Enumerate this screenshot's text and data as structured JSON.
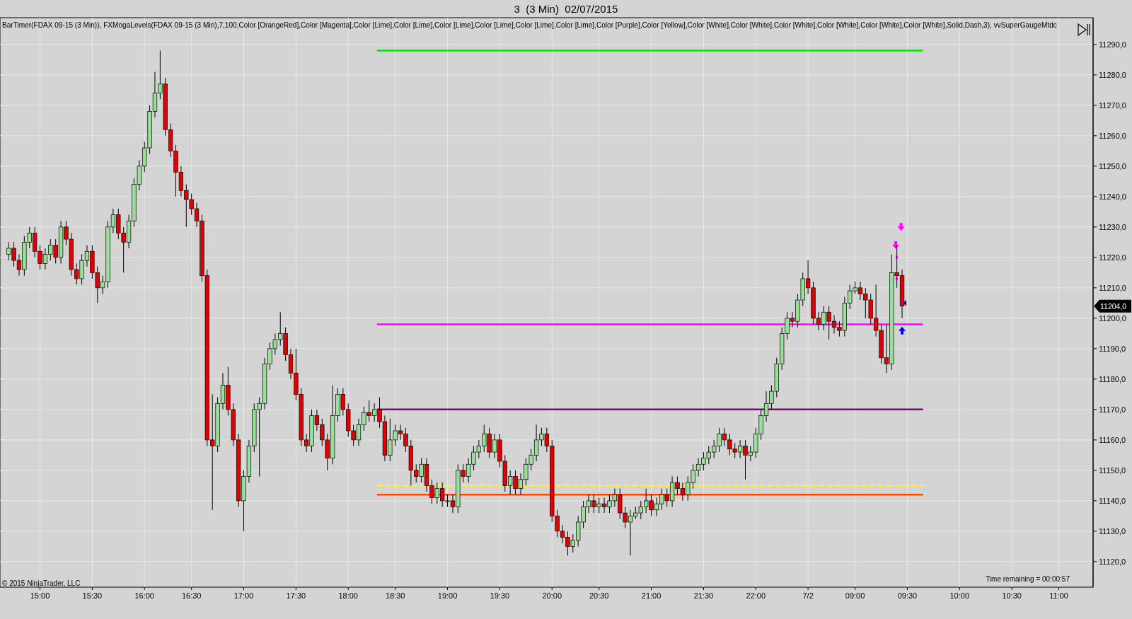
{
  "window": {
    "title": "3  (3 Min)  02/07/2015"
  },
  "chart": {
    "indicator_text": "BarTimer(FDAX 09-15 (3 Min)), FXMogaLevels(FDAX 09-15 (3 Min),7,100,Color [OrangeRed],Color [Magenta],Color [Lime],Color [Lime],Color [Lime],Color [Lime],Color [Lime],Color [Lime],Color [Purple],Color [Yellow],Color [White],Color [White],Color [White],Color [White],Color [White],Color [White],Solid,Dash,3), vvSuperGaugeMtdc",
    "copyright": "© 2015 NinjaTrader, LLC",
    "time_remaining": "Time remaining = 00:00:57",
    "last_price_label": "11204,0",
    "chart_data": {
      "type": "candlestick",
      "grid": true,
      "ylim": [
        11111.6,
        11298.8
      ],
      "categories": [
        null,
        null,
        null,
        null,
        null,
        null,
        "15:00",
        null,
        null,
        null,
        null,
        null,
        null,
        null,
        null,
        null,
        "15:30",
        null,
        null,
        null,
        null,
        null,
        null,
        null,
        null,
        null,
        "16:00",
        null,
        null,
        null,
        null,
        null,
        null,
        null,
        null,
        "16:30",
        null,
        null,
        null,
        null,
        null,
        null,
        null,
        null,
        null,
        "17:00",
        null,
        null,
        null,
        null,
        null,
        null,
        null,
        null,
        null,
        "17:30",
        null,
        null,
        null,
        null,
        null,
        null,
        null,
        null,
        null,
        "18:00",
        null,
        null,
        null,
        null,
        null,
        null,
        null,
        null,
        "18:30",
        null,
        null,
        null,
        null,
        null,
        null,
        null,
        null,
        null,
        "19:00",
        null,
        null,
        null,
        null,
        null,
        null,
        null,
        null,
        null,
        "19:30",
        null,
        null,
        null,
        null,
        null,
        null,
        null,
        null,
        null,
        "20:00",
        null,
        null,
        null,
        null,
        null,
        null,
        null,
        null,
        "20:30",
        null,
        null,
        null,
        null,
        null,
        null,
        null,
        null,
        null,
        "21:00",
        null,
        null,
        null,
        null,
        null,
        null,
        null,
        null,
        null,
        "21:30",
        null,
        null,
        null,
        null,
        null,
        null,
        null,
        null,
        null,
        "22:00",
        null,
        null,
        null,
        null,
        null,
        null,
        null,
        null,
        null,
        "7/2",
        null,
        null,
        null,
        null,
        null,
        null,
        null,
        null,
        "09:00",
        null,
        null,
        null,
        null,
        null,
        null,
        null,
        null,
        null,
        "09:30",
        null,
        null,
        null,
        null,
        null,
        null,
        null,
        null,
        null,
        "10:00",
        null,
        null,
        null,
        null,
        null,
        null,
        null,
        null,
        null,
        "10:30",
        null,
        null,
        null,
        null,
        null,
        null,
        null,
        null,
        "11:00",
        null,
        null,
        null,
        null,
        null,
        null
      ],
      "yticks": [
        {
          "value": 11120,
          "label": "11120,0"
        },
        {
          "value": 11130,
          "label": "11130,0"
        },
        {
          "value": 11140,
          "label": "11140,0"
        },
        {
          "value": 11150,
          "label": "11150,0"
        },
        {
          "value": 11160,
          "label": "11160,0"
        },
        {
          "value": 11170,
          "label": "11170,0"
        },
        {
          "value": 11180,
          "label": "11180,0"
        },
        {
          "value": 11190,
          "label": "11190,0"
        },
        {
          "value": 11200,
          "label": "11200,0"
        },
        {
          "value": 11210,
          "label": "11210,0"
        },
        {
          "value": 11220,
          "label": "11220,0"
        },
        {
          "value": 11230,
          "label": "11230,0"
        },
        {
          "value": 11240,
          "label": "11240,0"
        },
        {
          "value": 11250,
          "label": "11250,0"
        },
        {
          "value": 11260,
          "label": "11260,0"
        },
        {
          "value": 11270,
          "label": "11270,0"
        },
        {
          "value": 11280,
          "label": "11280,0"
        },
        {
          "value": 11290,
          "label": "11290,0"
        }
      ],
      "ohlc": [
        [
          11221,
          11225,
          11219,
          11223
        ],
        [
          11223,
          11225,
          11217,
          11219
        ],
        [
          11219,
          11221,
          11214,
          11216
        ],
        [
          11216,
          11227,
          11214,
          11225
        ],
        [
          11225,
          11230,
          11223,
          11228
        ],
        [
          11228,
          11230,
          11220,
          11222
        ],
        [
          11222,
          11224,
          11216,
          11218
        ],
        [
          11218,
          11223,
          11216,
          11221
        ],
        [
          11221,
          11226,
          11219,
          11224
        ],
        [
          11224,
          11226,
          11218,
          11220
        ],
        [
          11220,
          11232,
          11218,
          11230
        ],
        [
          11230,
          11232,
          11224,
          11226
        ],
        [
          11226,
          11228,
          11214,
          11216
        ],
        [
          11216,
          11218,
          11211,
          11213
        ],
        [
          11213,
          11221,
          11211,
          11219
        ],
        [
          11219,
          11224,
          11217,
          11222
        ],
        [
          11222,
          11224,
          11213,
          11215
        ],
        [
          11215,
          11217,
          11205,
          11210
        ],
        [
          11210,
          11214,
          11208,
          11212
        ],
        [
          11212,
          11232,
          11210,
          11230
        ],
        [
          11230,
          11236,
          11228,
          11234
        ],
        [
          11234,
          11236,
          11226,
          11228
        ],
        [
          11228,
          11230,
          11215,
          11225
        ],
        [
          11225,
          11234,
          11223,
          11232
        ],
        [
          11232,
          11246,
          11230,
          11244
        ],
        [
          11244,
          11252,
          11242,
          11250
        ],
        [
          11250,
          11258,
          11248,
          11256
        ],
        [
          11256,
          11270,
          11254,
          11268
        ],
        [
          11268,
          11281,
          11266,
          11274
        ],
        [
          11274,
          11288,
          11272,
          11277
        ],
        [
          11277,
          11279,
          11260,
          11262
        ],
        [
          11262,
          11264,
          11253,
          11255
        ],
        [
          11255,
          11257,
          11240,
          11248
        ],
        [
          11248,
          11250,
          11240,
          11242
        ],
        [
          11242,
          11244,
          11230,
          11239
        ],
        [
          11239,
          11241,
          11234,
          11236
        ],
        [
          11236,
          11238,
          11230,
          11232
        ],
        [
          11232,
          11234,
          11212,
          11214
        ],
        [
          11214,
          11216,
          11158,
          11160
        ],
        [
          11160,
          11175,
          11137,
          11158
        ],
        [
          11158,
          11174,
          11156,
          11172
        ],
        [
          11172,
          11182,
          11170,
          11178
        ],
        [
          11178,
          11184,
          11168,
          11170
        ],
        [
          11170,
          11172,
          11158,
          11160
        ],
        [
          11160,
          11162,
          11138,
          11140
        ],
        [
          11140,
          11150,
          11130,
          11148
        ],
        [
          11148,
          11160,
          11146,
          11158
        ],
        [
          11158,
          11172,
          11156,
          11170
        ],
        [
          11170,
          11174,
          11148,
          11172
        ],
        [
          11172,
          11187,
          11170,
          11185
        ],
        [
          11185,
          11192,
          11183,
          11190
        ],
        [
          11190,
          11195,
          11188,
          11193
        ],
        [
          11193,
          11202,
          11191,
          11195
        ],
        [
          11195,
          11197,
          11186,
          11188
        ],
        [
          11188,
          11190,
          11180,
          11182
        ],
        [
          11182,
          11190,
          11173,
          11175
        ],
        [
          11175,
          11177,
          11158,
          11160
        ],
        [
          11160,
          11162,
          11156,
          11158
        ],
        [
          11158,
          11170,
          11156,
          11168
        ],
        [
          11168,
          11170,
          11163,
          11165
        ],
        [
          11165,
          11167,
          11158,
          11160
        ],
        [
          11160,
          11162,
          11150,
          11154
        ],
        [
          11154,
          11178,
          11152,
          11168
        ],
        [
          11168,
          11177,
          11166,
          11175
        ],
        [
          11175,
          11177,
          11168,
          11170
        ],
        [
          11170,
          11172,
          11161,
          11163
        ],
        [
          11163,
          11165,
          11158,
          11160
        ],
        [
          11160,
          11167,
          11158,
          11165
        ],
        [
          11165,
          11171,
          11163,
          11169
        ],
        [
          11169,
          11173,
          11166,
          11168
        ],
        [
          11168,
          11172,
          11166,
          11170
        ],
        [
          11170,
          11174,
          11164,
          11166
        ],
        [
          11166,
          11168,
          11153,
          11155
        ],
        [
          11155,
          11167,
          11153,
          11160
        ],
        [
          11160,
          11165,
          11158,
          11163
        ],
        [
          11163,
          11165,
          11160,
          11162
        ],
        [
          11162,
          11164,
          11156,
          11158
        ],
        [
          11158,
          11160,
          11145,
          11150
        ],
        [
          11150,
          11152,
          11146,
          11148
        ],
        [
          11148,
          11154,
          11146,
          11152
        ],
        [
          11152,
          11154,
          11143,
          11145
        ],
        [
          11145,
          11147,
          11139,
          11141
        ],
        [
          11141,
          11146,
          11139,
          11144
        ],
        [
          11144,
          11146,
          11138,
          11140
        ],
        [
          11140,
          11142,
          11138,
          11140
        ],
        [
          11140,
          11142,
          11136,
          11138
        ],
        [
          11138,
          11152,
          11136,
          11150
        ],
        [
          11150,
          11152,
          11146,
          11148
        ],
        [
          11148,
          11154,
          11146,
          11152
        ],
        [
          11152,
          11158,
          11150,
          11156
        ],
        [
          11156,
          11160,
          11154,
          11158
        ],
        [
          11158,
          11165,
          11156,
          11162
        ],
        [
          11162,
          11164,
          11154,
          11156
        ],
        [
          11156,
          11162,
          11154,
          11160
        ],
        [
          11160,
          11162,
          11151,
          11153
        ],
        [
          11153,
          11155,
          11143,
          11145
        ],
        [
          11145,
          11150,
          11142,
          11148
        ],
        [
          11148,
          11150,
          11142,
          11144
        ],
        [
          11144,
          11149,
          11142,
          11147
        ],
        [
          11147,
          11154,
          11145,
          11152
        ],
        [
          11152,
          11157,
          11150,
          11155
        ],
        [
          11155,
          11165,
          11153,
          11160
        ],
        [
          11160,
          11164,
          11158,
          11162
        ],
        [
          11162,
          11164,
          11156,
          11158
        ],
        [
          11158,
          11160,
          11133,
          11135
        ],
        [
          11135,
          11137,
          11128,
          11130
        ],
        [
          11130,
          11132,
          11126,
          11128
        ],
        [
          11128,
          11130,
          11122,
          11125
        ],
        [
          11125,
          11129,
          11123,
          11127
        ],
        [
          11127,
          11135,
          11125,
          11133
        ],
        [
          11133,
          11140,
          11131,
          11138
        ],
        [
          11138,
          11142,
          11136,
          11140
        ],
        [
          11140,
          11142,
          11136,
          11138
        ],
        [
          11138,
          11141,
          11136,
          11139
        ],
        [
          11139,
          11141,
          11136,
          11138
        ],
        [
          11138,
          11142,
          11136,
          11140
        ],
        [
          11140,
          11144,
          11138,
          11142
        ],
        [
          11142,
          11144,
          11134,
          11136
        ],
        [
          11136,
          11138,
          11131,
          11133
        ],
        [
          11133,
          11137,
          11122,
          11135
        ],
        [
          11135,
          11138,
          11134,
          11136
        ],
        [
          11136,
          11140,
          11134,
          11138
        ],
        [
          11138,
          11144,
          11136,
          11140
        ],
        [
          11140,
          11142,
          11135,
          11137
        ],
        [
          11137,
          11141,
          11135,
          11139
        ],
        [
          11139,
          11144,
          11137,
          11142
        ],
        [
          11142,
          11144,
          11138,
          11140
        ],
        [
          11140,
          11148,
          11138,
          11146
        ],
        [
          11146,
          11148,
          11142,
          11144
        ],
        [
          11144,
          11146,
          11140,
          11142
        ],
        [
          11142,
          11148,
          11140,
          11146
        ],
        [
          11146,
          11152,
          11144,
          11150
        ],
        [
          11150,
          11154,
          11148,
          11152
        ],
        [
          11152,
          11156,
          11150,
          11154
        ],
        [
          11154,
          11158,
          11152,
          11156
        ],
        [
          11156,
          11160,
          11154,
          11158
        ],
        [
          11158,
          11164,
          11156,
          11162
        ],
        [
          11162,
          11164,
          11158,
          11160
        ],
        [
          11160,
          11162,
          11155,
          11157
        ],
        [
          11157,
          11159,
          11154,
          11156
        ],
        [
          11156,
          11160,
          11154,
          11158
        ],
        [
          11158,
          11160,
          11147,
          11155
        ],
        [
          11155,
          11158,
          11153,
          11156
        ],
        [
          11156,
          11164,
          11154,
          11162
        ],
        [
          11162,
          11170,
          11160,
          11168
        ],
        [
          11168,
          11176,
          11166,
          11172
        ],
        [
          11172,
          11178,
          11170,
          11176
        ],
        [
          11176,
          11187,
          11174,
          11185
        ],
        [
          11185,
          11197,
          11183,
          11195
        ],
        [
          11195,
          11202,
          11193,
          11200
        ],
        [
          11200,
          11202,
          11197,
          11199
        ],
        [
          11199,
          11208,
          11197,
          11206
        ],
        [
          11206,
          11215,
          11204,
          11213
        ],
        [
          11213,
          11219,
          11208,
          11210
        ],
        [
          11210,
          11212,
          11198,
          11200
        ],
        [
          11200,
          11202,
          11196,
          11198
        ],
        [
          11198,
          11204,
          11196,
          11202
        ],
        [
          11202,
          11204,
          11193,
          11199
        ],
        [
          11199,
          11201,
          11195,
          11197
        ],
        [
          11197,
          11199,
          11194,
          11196
        ],
        [
          11196,
          11207,
          11194,
          11205
        ],
        [
          11205,
          11211,
          11203,
          11209
        ],
        [
          11209,
          11212,
          11208,
          11210
        ],
        [
          11210,
          11212,
          11206,
          11208
        ],
        [
          11208,
          11210,
          11200,
          11206
        ],
        [
          11206,
          11208,
          11198,
          11200
        ],
        [
          11200,
          11211,
          11194,
          11196
        ],
        [
          11196,
          11198,
          11185,
          11187
        ],
        [
          11187,
          11198,
          11182,
          11185
        ],
        [
          11185,
          11221,
          11183,
          11215
        ],
        [
          11215,
          11224,
          11210,
          11214
        ],
        [
          11214,
          11216,
          11200,
          11204
        ],
        null,
        null,
        null,
        null,
        null,
        null,
        null,
        null,
        null,
        null,
        null,
        null,
        null,
        null,
        null,
        null,
        null,
        null,
        null,
        null,
        null,
        null,
        null,
        null,
        null,
        null,
        null,
        null,
        null,
        null,
        null,
        null,
        null,
        null,
        null,
        null
      ],
      "ref_lines": [
        {
          "axis": "y",
          "value": 11288,
          "color": "#00e600"
        },
        {
          "axis": "y",
          "value": 11198,
          "color": "#ff00ff"
        },
        {
          "axis": "y",
          "value": 11170,
          "color": "#800080"
        },
        {
          "axis": "y",
          "value": 11145,
          "color": "#ffff00"
        },
        {
          "axis": "y",
          "value": 11142,
          "color": "#ff4500"
        }
      ]
    }
  }
}
